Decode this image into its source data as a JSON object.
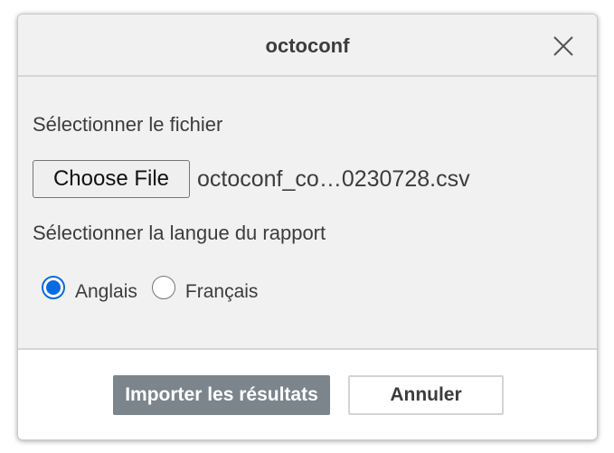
{
  "dialog": {
    "title": "octoconf",
    "close_icon": "close-icon"
  },
  "file_section": {
    "label": "Sélectionner le fichier",
    "button_label": "Choose File",
    "file_name": "octoconf_co…0230728.csv"
  },
  "language_section": {
    "label": "Sélectionner la langue du rapport",
    "options": [
      {
        "label": "Anglais",
        "checked": true
      },
      {
        "label": "Français",
        "checked": false
      }
    ]
  },
  "footer": {
    "import_label": "Importer les résultats",
    "cancel_label": "Annuler"
  },
  "colors": {
    "accent": "#0a6ae0",
    "primary_button": "#7c858c",
    "panel_bg": "#f1f1f1"
  }
}
